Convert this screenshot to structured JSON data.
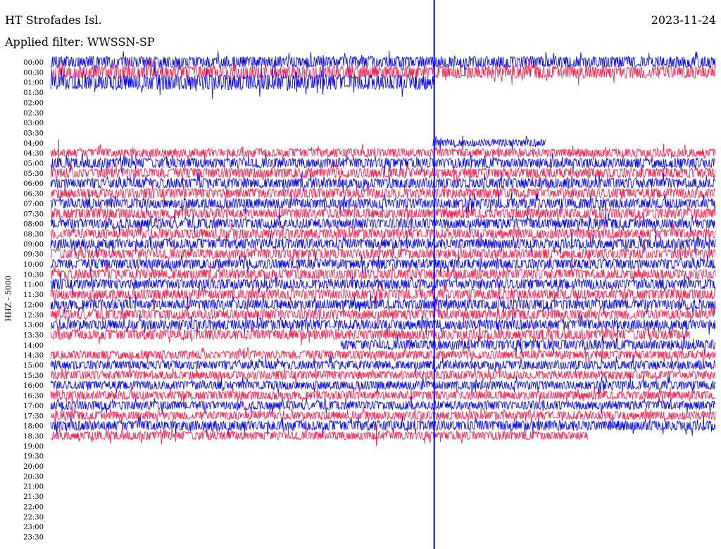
{
  "header": {
    "station": "HT Strofades Isl.",
    "date": "2023-11-24",
    "filter": "Applied filter: WWSSN-SP"
  },
  "side_label": "HHZ - 5000",
  "chart_data": {
    "type": "line",
    "title": "HT Strofades Isl.",
    "subtitle": "Applied filter: WWSSN-SP",
    "ylabel": "HHZ - 5000",
    "rows": [
      "00:00",
      "00:30",
      "01:00",
      "01:30",
      "02:00",
      "02:30",
      "03:00",
      "03:30",
      "04:00",
      "04:30",
      "05:00",
      "05:30",
      "06:00",
      "06:30",
      "07:00",
      "07:30",
      "08:00",
      "08:30",
      "09:00",
      "09:30",
      "10:00",
      "10:30",
      "11:00",
      "11:30",
      "12:00",
      "12:30",
      "13:00",
      "13:30",
      "14:00",
      "14:30",
      "15:00",
      "15:30",
      "16:00",
      "16:30",
      "17:00",
      "17:30",
      "18:00",
      "18:30",
      "19:00",
      "19:30",
      "20:00",
      "20:30",
      "21:00",
      "21:30",
      "22:00",
      "22:30",
      "23:00",
      "23:30"
    ],
    "row_minutes": 30,
    "series_colors": [
      "#0000ff",
      "#ff1a4a"
    ],
    "marker_line_color": "#0000ff",
    "marker_fraction": 0.577,
    "traces": [
      {
        "row": 0,
        "start": 0,
        "end": 1,
        "amp": 8,
        "color": "#0000ff"
      },
      {
        "row": 1,
        "start": 0,
        "end": 1,
        "amp": 9,
        "color": "#ff1a4a"
      },
      {
        "row": 2,
        "start": 0,
        "end": 0.577,
        "amp": 11,
        "color": "#0000ff"
      },
      {
        "row": 8,
        "start": 0.575,
        "end": 0.745,
        "amp": 5,
        "color": "#0000ff"
      },
      {
        "row": 9,
        "start": 0,
        "end": 1,
        "amp": 6,
        "color": "#ff1a4a"
      },
      {
        "row": 10,
        "start": 0,
        "end": 1,
        "amp": 7,
        "color": "#0000ff"
      },
      {
        "row": 11,
        "start": 0,
        "end": 1,
        "amp": 7,
        "color": "#ff1a4a"
      },
      {
        "row": 12,
        "start": 0,
        "end": 1,
        "amp": 7,
        "color": "#0000ff"
      },
      {
        "row": 13,
        "start": 0,
        "end": 1,
        "amp": 7,
        "color": "#ff1a4a"
      },
      {
        "row": 14,
        "start": 0,
        "end": 1,
        "amp": 7,
        "color": "#0000ff"
      },
      {
        "row": 15,
        "start": 0,
        "end": 1,
        "amp": 7,
        "color": "#ff1a4a"
      },
      {
        "row": 16,
        "start": 0,
        "end": 1,
        "amp": 7,
        "color": "#0000ff"
      },
      {
        "row": 17,
        "start": 0,
        "end": 1,
        "amp": 7,
        "color": "#ff1a4a"
      },
      {
        "row": 18,
        "start": 0,
        "end": 1,
        "amp": 7,
        "color": "#0000ff"
      },
      {
        "row": 19,
        "start": 0,
        "end": 1,
        "amp": 7,
        "color": "#ff1a4a"
      },
      {
        "row": 20,
        "start": 0,
        "end": 1,
        "amp": 7,
        "color": "#0000ff"
      },
      {
        "row": 21,
        "start": 0,
        "end": 1,
        "amp": 7,
        "color": "#ff1a4a"
      },
      {
        "row": 22,
        "start": 0,
        "end": 1,
        "amp": 7,
        "color": "#0000ff"
      },
      {
        "row": 23,
        "start": 0,
        "end": 1,
        "amp": 7,
        "color": "#ff1a4a"
      },
      {
        "row": 24,
        "start": 0,
        "end": 1,
        "amp": 7,
        "color": "#0000ff"
      },
      {
        "row": 25,
        "start": 0,
        "end": 1,
        "amp": 7,
        "color": "#ff1a4a"
      },
      {
        "row": 26,
        "start": 0,
        "end": 1,
        "amp": 7,
        "color": "#0000ff"
      },
      {
        "row": 27,
        "start": 0,
        "end": 0.962,
        "amp": 7,
        "color": "#ff1a4a"
      },
      {
        "row": 28,
        "start": 0.436,
        "end": 1,
        "amp": 7,
        "color": "#0000ff"
      },
      {
        "row": 29,
        "start": 0,
        "end": 1,
        "amp": 6,
        "color": "#ff1a4a"
      },
      {
        "row": 30,
        "start": 0,
        "end": 1,
        "amp": 6,
        "color": "#0000ff"
      },
      {
        "row": 31,
        "start": 0,
        "end": 1,
        "amp": 6,
        "color": "#ff1a4a"
      },
      {
        "row": 32,
        "start": 0,
        "end": 1,
        "amp": 6,
        "color": "#0000ff"
      },
      {
        "row": 33,
        "start": 0,
        "end": 1,
        "amp": 6,
        "color": "#ff1a4a"
      },
      {
        "row": 34,
        "start": 0,
        "end": 1,
        "amp": 6,
        "color": "#0000ff"
      },
      {
        "row": 35,
        "start": 0,
        "end": 1,
        "amp": 6,
        "color": "#ff1a4a"
      },
      {
        "row": 36,
        "start": 0,
        "end": 1,
        "amp": 7,
        "color": "#0000ff"
      },
      {
        "row": 37,
        "start": 0,
        "end": 0.808,
        "amp": 6,
        "color": "#ff1a4a"
      }
    ],
    "bursts": [
      {
        "row": 1,
        "at": 0.41,
        "height": 48,
        "color": "#0000ff"
      },
      {
        "row": 2,
        "at": 0.37,
        "height": 28,
        "color": "#0000ff"
      },
      {
        "row": 9,
        "at": 0.012,
        "height": 38,
        "color": "#ff1a4a"
      },
      {
        "row": 8,
        "at": 0.62,
        "height": 20,
        "color": "#0000ff"
      },
      {
        "row": 27,
        "at": 0.645,
        "height": 18,
        "color": "#ff1a4a"
      },
      {
        "row": 27,
        "at": 0.74,
        "height": 14,
        "color": "#ff1a4a"
      },
      {
        "row": 37,
        "at": 0.49,
        "height": 28,
        "color": "#ff1a4a"
      }
    ]
  }
}
